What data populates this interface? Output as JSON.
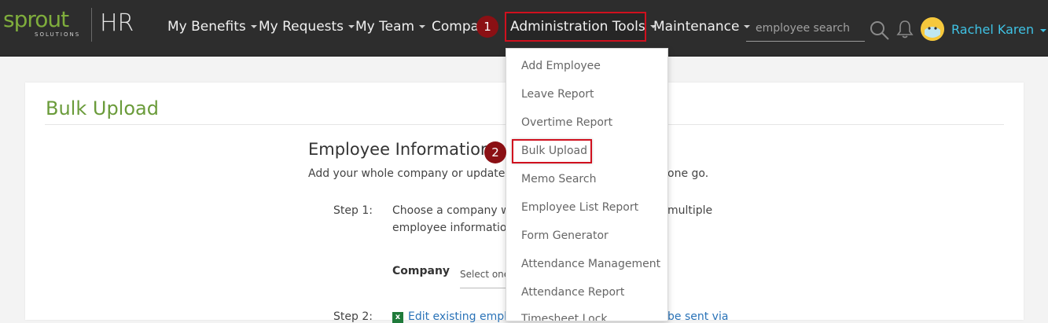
{
  "brand": {
    "logo_word": "sprout",
    "logo_sub": "SOLUTIONS",
    "product": "HR"
  },
  "nav": {
    "items": [
      {
        "label": "My Benefits"
      },
      {
        "label": "My Requests"
      },
      {
        "label": "My Team"
      },
      {
        "label": "Compan"
      },
      {
        "label": "Administration Tools"
      },
      {
        "label": "Maintenance"
      }
    ]
  },
  "search": {
    "placeholder": "employee search"
  },
  "user": {
    "name": "Rachel Karen"
  },
  "markers": {
    "one": "1",
    "two": "2"
  },
  "dropdown": {
    "items": [
      {
        "label": "Add Employee"
      },
      {
        "label": "Leave Report"
      },
      {
        "label": "Overtime Report"
      },
      {
        "label": "Bulk Upload"
      },
      {
        "label": "Memo Search"
      },
      {
        "label": "Employee List Report"
      },
      {
        "label": "Form Generator"
      },
      {
        "label": "Attendance Management"
      },
      {
        "label": "Attendance Report"
      },
      {
        "label": "Timesheet Lock"
      }
    ]
  },
  "page": {
    "title": "Bulk Upload",
    "section_title": "Employee Information",
    "section_desc_left": "Add your whole company or update m",
    "section_desc_right": "one go.",
    "step1_label": "Step 1:",
    "step1_text_line1": "Choose a company wh",
    "step1_text_line1_right": "multiple",
    "step1_text_line2": "employee information",
    "company_label": "Company",
    "company_select": "Select one",
    "step2_label": "Step 2:",
    "step2_link_left": "Edit existing emplo",
    "step2_link_right": "be sent via"
  },
  "colors": {
    "accent_green": "#6a9b3a",
    "topbar": "#2d2d2d",
    "highlight_red": "#d0101e",
    "user_blue": "#3fc2e4"
  }
}
